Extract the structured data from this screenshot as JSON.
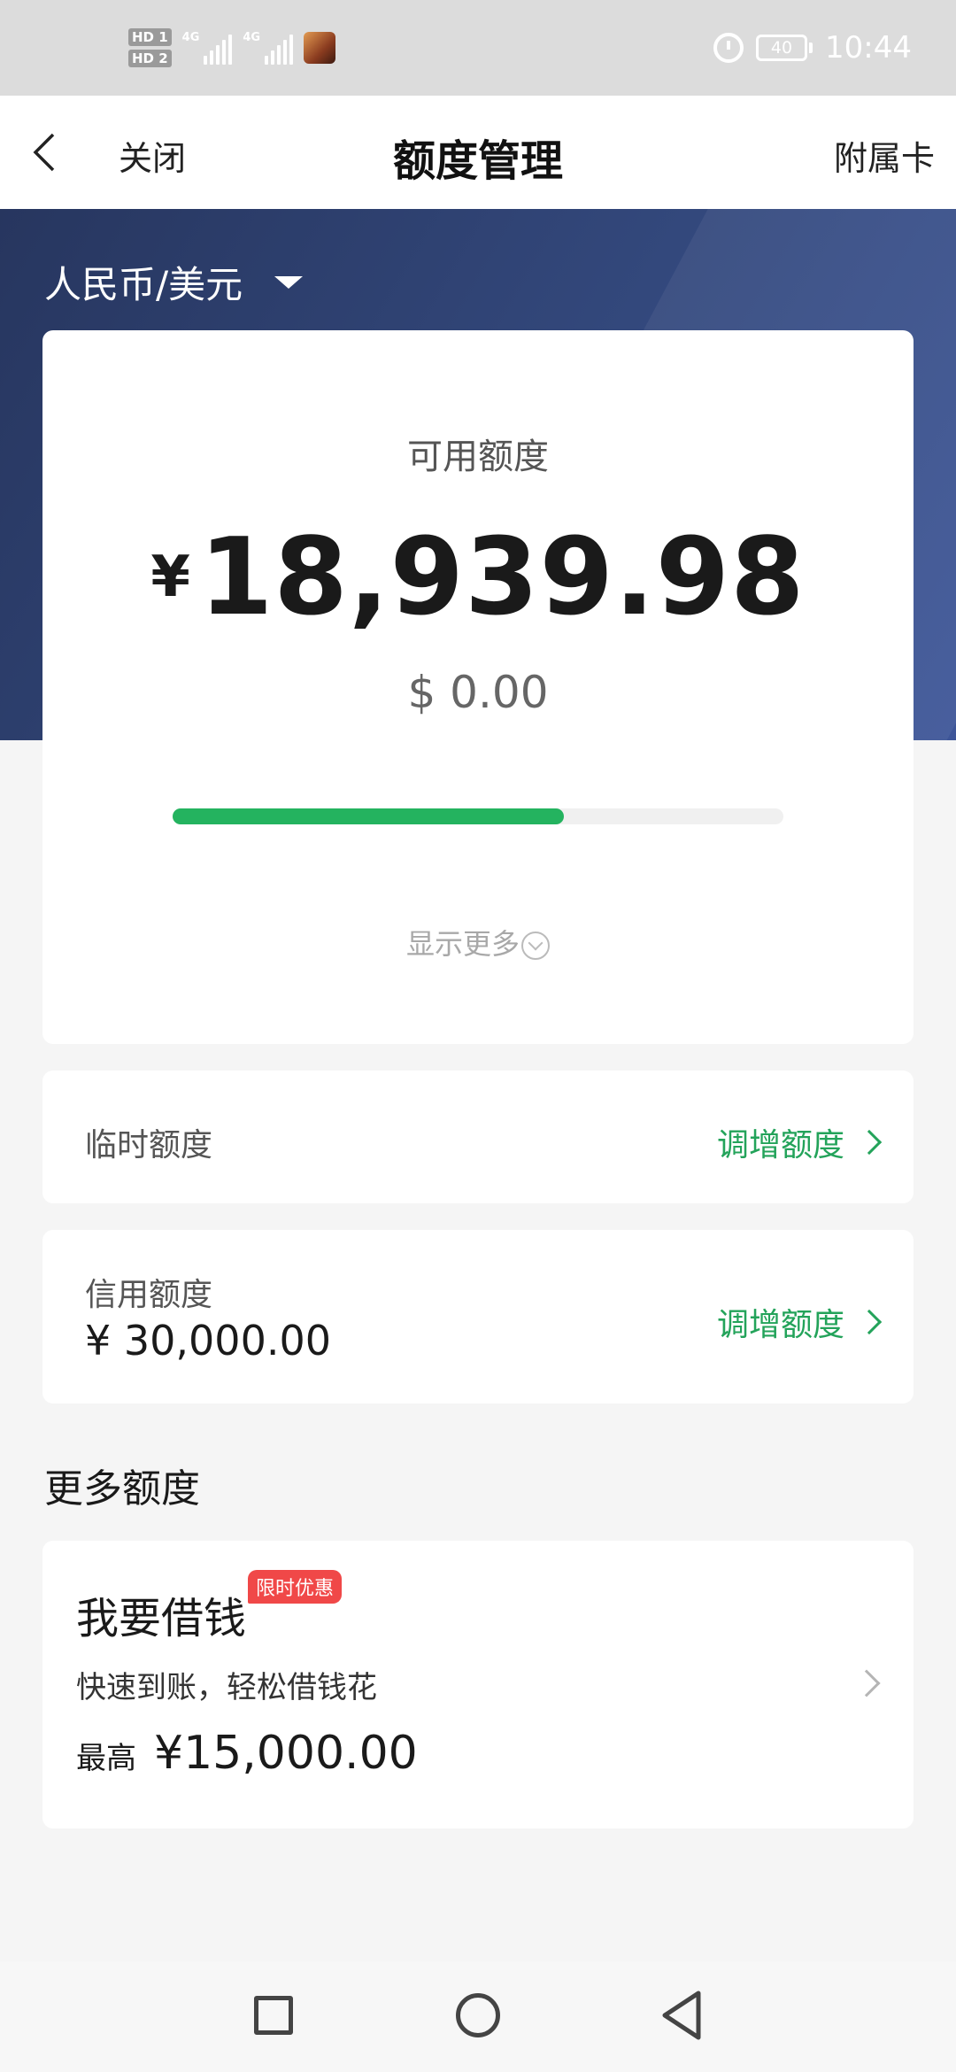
{
  "status_bar": {
    "hd1": "HD 1",
    "hd2": "HD 2",
    "net1": "4G",
    "net2": "4G",
    "battery": "40",
    "time": "10:44"
  },
  "nav": {
    "close_label": "关闭",
    "title": "额度管理",
    "right_label": "附属卡"
  },
  "currency_selector": "人民币/美元",
  "available": {
    "label": "可用额度",
    "currency_symbol": "¥",
    "amount": "18,939.98",
    "usd": "$ 0.00",
    "progress_fraction": 0.64,
    "show_more": "显示更多"
  },
  "temp_limit": {
    "label": "临时额度",
    "action": "调增额度"
  },
  "credit_limit": {
    "label": "信用额度",
    "value": "¥ 30,000.00",
    "action": "调增额度"
  },
  "more_section_title": "更多额度",
  "loan": {
    "title": "我要借钱",
    "badge": "限时优惠",
    "desc": "快速到账，轻松借钱花",
    "max_prefix": "最高",
    "max_amount": "¥15,000.00"
  },
  "colors": {
    "accent_green": "#23a35a",
    "header_blue": "#2f4373",
    "badge_red": "#f04848"
  }
}
